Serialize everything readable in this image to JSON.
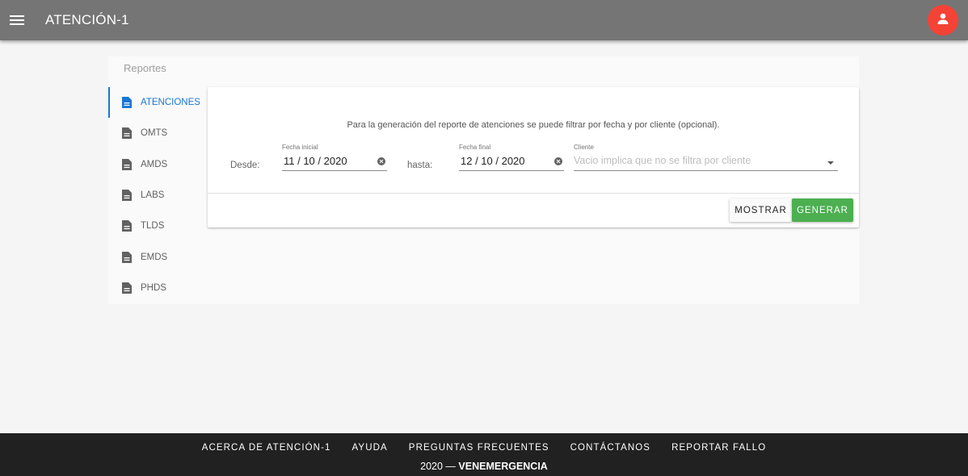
{
  "app": {
    "title": "ATENCIÓN-1",
    "menu_icon": "menu-icon",
    "user_icon": "account-icon",
    "avatar_color": "#f44336",
    "appbar_color": "#757575"
  },
  "section_label": "Reportes",
  "nav": {
    "items": [
      {
        "label": "ATENCIONES",
        "icon": "document-icon",
        "active": true
      },
      {
        "label": "OMTS",
        "icon": "document-icon",
        "active": false
      },
      {
        "label": "AMDS",
        "icon": "document-icon",
        "active": false
      },
      {
        "label": "LABS",
        "icon": "document-icon",
        "active": false
      },
      {
        "label": "TLDS",
        "icon": "document-icon",
        "active": false
      },
      {
        "label": "EMDS",
        "icon": "document-icon",
        "active": false
      },
      {
        "label": "PHDS",
        "icon": "document-icon",
        "active": false
      }
    ],
    "active_color": "#1976d2"
  },
  "form": {
    "description": "Para la generación del reporte de atenciones se puede filtrar por fecha y por cliente (opcional).",
    "desde_label": "Desde:",
    "hasta_label": "hasta:",
    "fecha_inicial": {
      "caption": "Fecha inicial",
      "value": "11 / 10 / 2020"
    },
    "fecha_final": {
      "caption": "Fecha final",
      "value": "12 / 10 / 2020"
    },
    "cliente": {
      "caption": "Cliente",
      "placeholder": "Vacio implica que no se filtra por cliente"
    },
    "mostrar_label": "MOSTRAR",
    "generar_label": "GENERAR",
    "generar_color": "#4caf50"
  },
  "footer": {
    "links": [
      "ACERCA DE ATENCIÓN-1",
      "AYUDA",
      "PREGUNTAS FRECUENTES",
      "CONTÁCTANOS",
      "REPORTAR FALLO"
    ],
    "copyright_year": "2020 —",
    "copyright_name": "VENEMERGENCIA"
  }
}
